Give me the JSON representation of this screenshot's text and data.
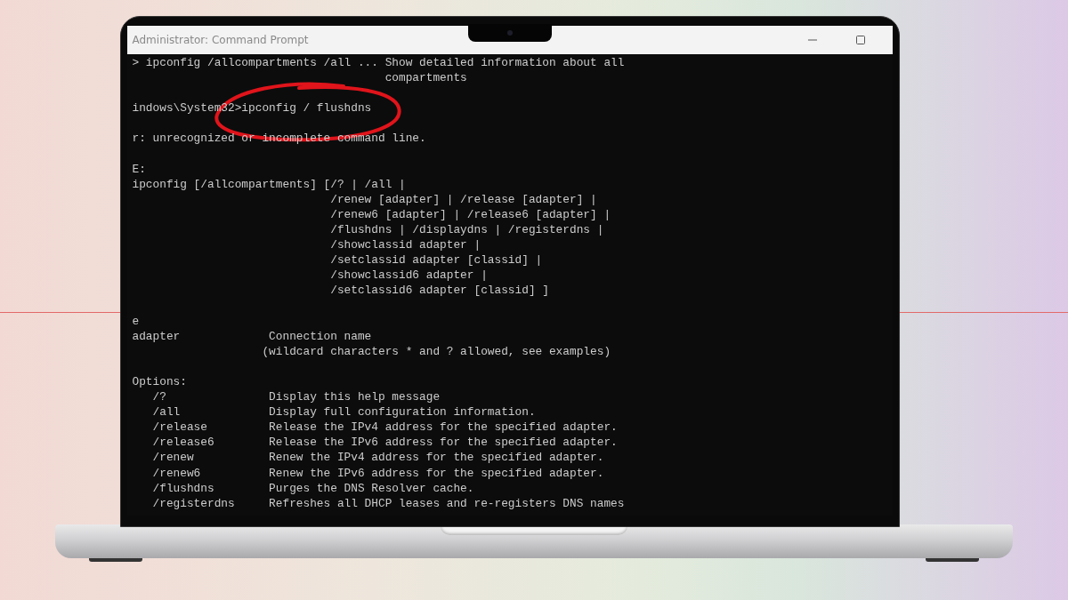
{
  "window": {
    "title": "Administrator: Command Prompt",
    "controls": [
      {
        "kind": "minimize"
      },
      {
        "kind": "maximize"
      }
    ]
  },
  "terminal": {
    "lines": [
      {
        "kind": "text",
        "text": "> ipconfig /allcompartments /all ... Show detailed information about all"
      },
      {
        "kind": "text",
        "text": "                                     compartments"
      },
      {
        "kind": "blank"
      },
      {
        "kind": "text",
        "text": "indows\\System32>ipconfig / flushdns"
      },
      {
        "kind": "blank"
      },
      {
        "kind": "text",
        "text": "r: unrecognized or incomplete command line."
      },
      {
        "kind": "blank"
      },
      {
        "kind": "text",
        "text": "E:"
      },
      {
        "kind": "text",
        "text": "ipconfig [/allcompartments] [/? | /all |"
      },
      {
        "kind": "text",
        "text": "                             /renew [adapter] | /release [adapter] |"
      },
      {
        "kind": "text",
        "text": "                             /renew6 [adapter] | /release6 [adapter] |"
      },
      {
        "kind": "text",
        "text": "                             /flushdns | /displaydns | /registerdns |"
      },
      {
        "kind": "text",
        "text": "                             /showclassid adapter |"
      },
      {
        "kind": "text",
        "text": "                             /setclassid adapter [classid] |"
      },
      {
        "kind": "text",
        "text": "                             /showclassid6 adapter |"
      },
      {
        "kind": "text",
        "text": "                             /setclassid6 adapter [classid] ]"
      },
      {
        "kind": "blank"
      },
      {
        "kind": "text",
        "text": "e"
      },
      {
        "kind": "text",
        "text": "adapter             Connection name"
      },
      {
        "kind": "text",
        "text": "                   (wildcard characters * and ? allowed, see examples)"
      },
      {
        "kind": "blank"
      },
      {
        "kind": "text",
        "text": "Options:"
      },
      {
        "kind": "text",
        "text": "   /?               Display this help message"
      },
      {
        "kind": "text",
        "text": "   /all             Display full configuration information."
      },
      {
        "kind": "text",
        "text": "   /release         Release the IPv4 address for the specified adapter."
      },
      {
        "kind": "text",
        "text": "   /release6        Release the IPv6 address for the specified adapter."
      },
      {
        "kind": "text",
        "text": "   /renew           Renew the IPv4 address for the specified adapter."
      },
      {
        "kind": "text",
        "text": "   /renew6          Renew the IPv6 address for the specified adapter."
      },
      {
        "kind": "text",
        "text": "   /flushdns        Purges the DNS Resolver cache."
      },
      {
        "kind": "text",
        "text": "   /registerdns     Refreshes all DHCP leases and re-registers DNS names"
      }
    ]
  }
}
